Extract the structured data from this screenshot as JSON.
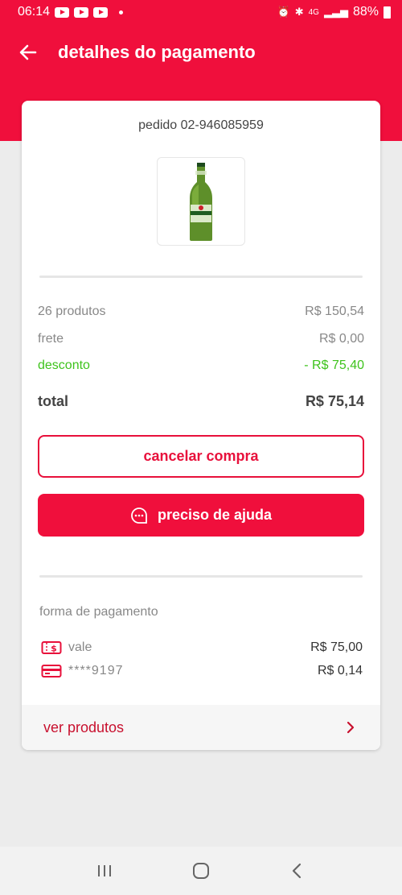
{
  "status_bar": {
    "time": "06:14",
    "battery": "88%",
    "network": "4G"
  },
  "header": {
    "title": "detalhes do pagamento"
  },
  "order": {
    "label": "pedido 02-946085959"
  },
  "summary": {
    "products_label": "26 produtos",
    "products_value": "R$ 150,54",
    "shipping_label": "frete",
    "shipping_value": "R$ 0,00",
    "discount_label": "desconto",
    "discount_value": "- R$ 75,40",
    "total_label": "total",
    "total_value": "R$ 75,14"
  },
  "buttons": {
    "cancel": "cancelar compra",
    "help": "preciso de ajuda"
  },
  "payment": {
    "section_label": "forma de pagamento",
    "methods": [
      {
        "label": "vale",
        "amount": "R$ 75,00",
        "icon": "voucher-icon"
      },
      {
        "label": "****9197",
        "amount": "R$ 0,14",
        "icon": "credit-card-icon"
      }
    ]
  },
  "footer": {
    "see_products": "ver produtos"
  },
  "colors": {
    "brand": "#f00f3c",
    "discount": "#3ec31c"
  }
}
